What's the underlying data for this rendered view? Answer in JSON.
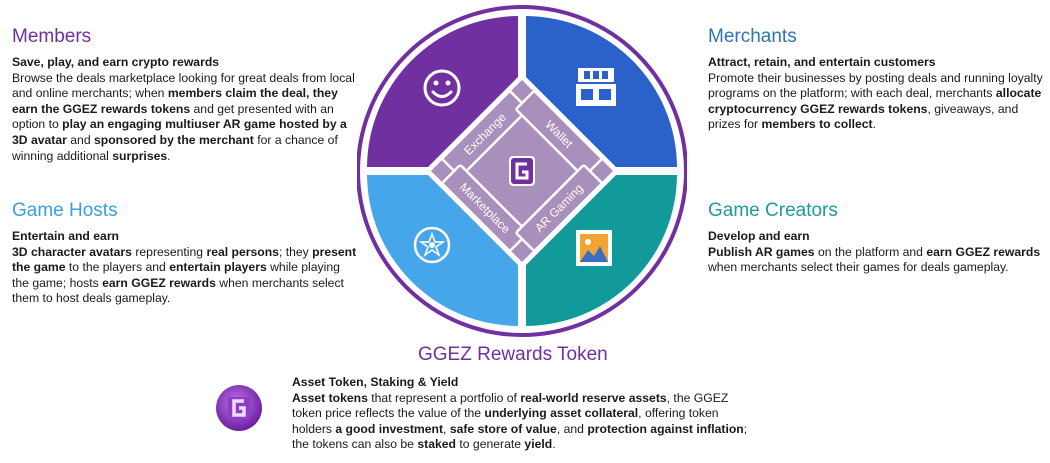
{
  "members": {
    "title": "Members",
    "subtitle": "Save, play, and earn crypto rewards",
    "segments": [
      {
        "t": "Browse the deals marketplace looking for great deals from local and online merchants; when ",
        "b": false
      },
      {
        "t": "members claim the deal, they earn the GGEZ rewards tokens",
        "b": true
      },
      {
        "t": " and get presented with an option to ",
        "b": false
      },
      {
        "t": "play an engaging multiuser AR game hosted by a 3D avatar",
        "b": true
      },
      {
        "t": " and ",
        "b": false
      },
      {
        "t": "sponsored by the merchant",
        "b": true
      },
      {
        "t": " for a chance of winning additional ",
        "b": false
      },
      {
        "t": "surprises",
        "b": true
      },
      {
        "t": ".",
        "b": false
      }
    ]
  },
  "game_hosts": {
    "title": "Game Hosts",
    "subtitle": "Entertain and earn",
    "segments": [
      {
        "t": "3D character avatars",
        "b": true
      },
      {
        "t": " representing ",
        "b": false
      },
      {
        "t": "real persons",
        "b": true
      },
      {
        "t": "; they ",
        "b": false
      },
      {
        "t": "present the game",
        "b": true
      },
      {
        "t": " to the players and ",
        "b": false
      },
      {
        "t": "entertain players",
        "b": true
      },
      {
        "t": " while playing the game; hosts ",
        "b": false
      },
      {
        "t": "earn GGEZ rewards",
        "b": true
      },
      {
        "t": " when merchants select them to host deals gameplay.",
        "b": false
      }
    ]
  },
  "merchants": {
    "title": "Merchants",
    "subtitle": "Attract, retain, and entertain customers",
    "segments": [
      {
        "t": "Promote their businesses by posting deals and running loyalty programs on the platform; with each deal, merchants ",
        "b": false
      },
      {
        "t": "allocate cryptocurrency GGEZ rewards tokens",
        "b": true
      },
      {
        "t": ", giveaways, and prizes for ",
        "b": false
      },
      {
        "t": "members to collect",
        "b": true
      },
      {
        "t": ".",
        "b": false
      }
    ]
  },
  "game_creators": {
    "title": "Game Creators",
    "subtitle": "Develop and earn",
    "segments": [
      {
        "t": "Publish AR games",
        "b": true
      },
      {
        "t": " on the platform and ",
        "b": false
      },
      {
        "t": "earn GGEZ rewards",
        "b": true
      },
      {
        "t": " when merchants select their games for deals gameplay.",
        "b": false
      }
    ]
  },
  "token": {
    "title": "GGEZ Rewards Token",
    "subtitle": "Asset Token, Staking & Yield",
    "segments": [
      {
        "t": "Asset tokens",
        "b": true
      },
      {
        "t": " that represent a portfolio of ",
        "b": false
      },
      {
        "t": "real-world reserve assets",
        "b": true
      },
      {
        "t": ", the GGEZ token price reflects the value of the ",
        "b": false
      },
      {
        "t": "underlying asset collateral",
        "b": true
      },
      {
        "t": ", offering token holders ",
        "b": false
      },
      {
        "t": "a good investment",
        "b": true
      },
      {
        "t": ", ",
        "b": false
      },
      {
        "t": "safe store of value",
        "b": true
      },
      {
        "t": ", and ",
        "b": false
      },
      {
        "t": "protection against inflation",
        "b": true
      },
      {
        "t": "; the tokens can also be ",
        "b": false
      },
      {
        "t": "staked",
        "b": true
      },
      {
        "t": " to generate ",
        "b": false
      },
      {
        "t": "yield",
        "b": true
      },
      {
        "t": ".",
        "b": false
      }
    ]
  },
  "wheel": {
    "labels": {
      "exchange": "Exchange",
      "wallet": "Wallet",
      "marketplace": "Marketplace",
      "ar_gaming": "AR Gaming"
    },
    "colors": {
      "top_left": "#7030a0",
      "top_right": "#2a62c9",
      "bottom_left": "#45a6ea",
      "bottom_right": "#129a9a",
      "ring": "#7030a0",
      "center": "#a98fbb"
    },
    "icons": {
      "top_left": "smiley-icon",
      "top_right": "storefront-icon",
      "bottom_left": "game-host-badge-icon",
      "bottom_right": "ar-game-picture-icon",
      "center": "ggez-logo-icon"
    }
  }
}
